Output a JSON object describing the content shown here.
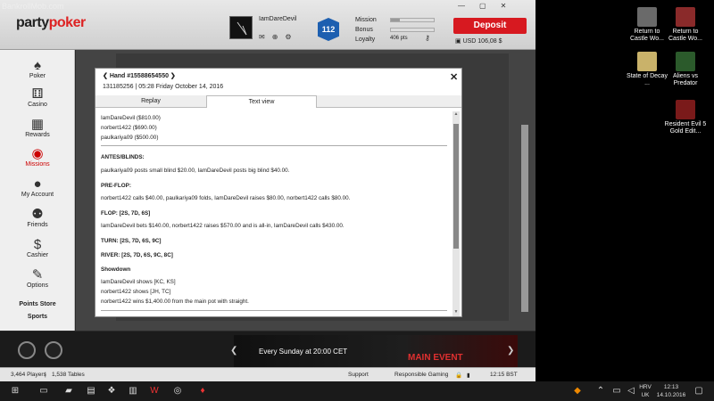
{
  "watermark": "BankrollMob.com",
  "app": {
    "logo_left": "party",
    "logo_right": "poker",
    "username": "IamDareDevil",
    "level": "112",
    "stats": {
      "mission_label": "Mission",
      "bonus_label": "Bonus",
      "loyalty_label": "Loyalty",
      "loyalty_pts": "406 pts",
      "mission_progress": 0.2
    },
    "deposit_label": "Deposit",
    "balance": "USD 106,08 $"
  },
  "sidebar": {
    "items": [
      {
        "label": "Poker",
        "icon": "spade-icon"
      },
      {
        "label": "Casino",
        "icon": "slots-icon"
      },
      {
        "label": "Rewards",
        "icon": "gift-icon"
      },
      {
        "label": "Missions",
        "icon": "target-icon"
      },
      {
        "label": "My Account",
        "icon": "person-icon"
      },
      {
        "label": "Friends",
        "icon": "friends-icon"
      },
      {
        "label": "Cashier",
        "icon": "dollar-icon"
      },
      {
        "label": "Options",
        "icon": "wrench-icon"
      }
    ],
    "points_store": "Points Store",
    "sports": "Sports"
  },
  "modal": {
    "hand_title": "Hand #15588654550",
    "hand_sub": "131185256 | 05:28 Friday October 14, 2016",
    "tabs": [
      "Replay",
      "Text view"
    ],
    "lines": [
      {
        "text": "IamDareDevil ($810.00)",
        "bold": false
      },
      {
        "text": "norbert1422 ($690.00)",
        "bold": false
      },
      {
        "text": "paulkariya09 ($500.00)",
        "bold": false
      },
      {
        "text": "ANTES/BLINDS:",
        "bold": true
      },
      {
        "text": "paulkariya09 posts small blind $20.00, IamDareDevil posts big blind $40.00.",
        "bold": false
      },
      {
        "text": "PRE-FLOP:",
        "bold": true
      },
      {
        "text": "norbert1422 calls $40.00, paulkariya09 folds, IamDareDevil raises $80.00, norbert1422 calls $80.00.",
        "bold": false
      },
      {
        "text": "FLOP: [2S, 7D, 6S]",
        "bold": true
      },
      {
        "text": "IamDareDevil bets $140.00, norbert1422 raises $570.00 and is all-in, IamDareDevil calls $430.00.",
        "bold": false
      },
      {
        "text": "TURN: [2S, 7D, 6S, 9C]",
        "bold": true
      },
      {
        "text": "RIVER: [2S, 7D, 6S, 9C, 8C]",
        "bold": true
      },
      {
        "text": "Showdown",
        "bold": true
      },
      {
        "text": "IamDareDevil shows [KC, KS]",
        "bold": false
      },
      {
        "text": "norbert1422 shows [JH, TC]",
        "bold": false
      },
      {
        "text": "norbert1422 wins $1,400.00 from the main pot with straight.",
        "bold": false
      }
    ]
  },
  "banner": {
    "text": "Every Sunday at 20:00 CET",
    "event": "MAIN EVENT"
  },
  "status": {
    "players": "3,464 Players",
    "tables": "1,538 Tables",
    "support": "Support",
    "responsible": "Responsible Gaming",
    "time": "12:15 BST"
  },
  "desktop_icons": [
    {
      "label": "Return to Castle Wo...",
      "color": "#6a6a6a"
    },
    {
      "label": "Return to Castle Wo...",
      "color": "#8a2a2a"
    },
    {
      "label": "State of Decay ...",
      "color": "#c9b26a"
    },
    {
      "label": "Aliens vs Predator",
      "color": "#2b5a2b"
    },
    {
      "label": "Resident Evil 5 Gold Edit...",
      "color": "#7a1a1a"
    }
  ],
  "taskbar": {
    "lang_top": "HRV",
    "lang_bottom": "UK",
    "clock_time": "12:13",
    "clock_date": "14.10.2016"
  },
  "colors": {
    "accent": "#d71920",
    "brand_dark": "#222222",
    "level_badge": "#1d5fb0"
  }
}
